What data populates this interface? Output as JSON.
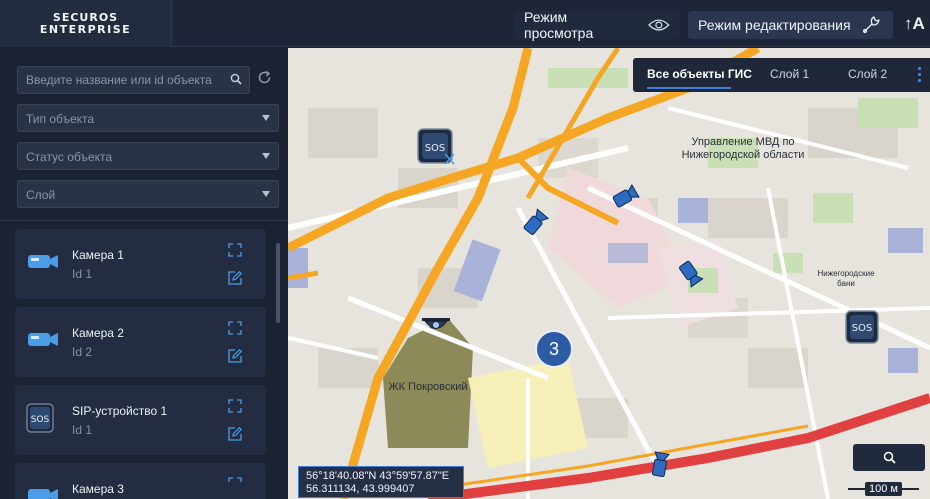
{
  "header": {
    "logo_line1": "SECUROS",
    "logo_line2": "ENTERPRISE",
    "view_mode_label": "Режим просмотра",
    "edit_mode_label": "Режим редактирования",
    "font_size_icon_text": "↑A"
  },
  "sidebar": {
    "search_placeholder": "Введите название или id объекта",
    "filters": [
      {
        "label": "Тип объекта"
      },
      {
        "label": "Статус объекта"
      },
      {
        "label": "Слой"
      }
    ],
    "objects": [
      {
        "name": "Камера 1",
        "id": "Id 1",
        "icon": "camera-icon"
      },
      {
        "name": "Камера 2",
        "id": "Id 2",
        "icon": "camera-icon"
      },
      {
        "name": "SIP-устройство 1",
        "id": "Id 1",
        "icon": "sos-phone-icon"
      },
      {
        "name": "Камера 3",
        "id": "",
        "icon": "camera-icon"
      }
    ]
  },
  "map": {
    "layer_tabs": [
      {
        "label": "Все объекты ГИС",
        "active": true
      },
      {
        "label": "Слой 1",
        "active": false
      },
      {
        "label": "Слой 2",
        "active": false
      }
    ],
    "labels": {
      "mvd_line1": "Управление МВД по",
      "mvd_line2": "Нижегородской области",
      "zhk": "ЖК Покровский",
      "banks": "Нижегородские бани"
    },
    "cluster_count": "3",
    "coords_dms": "56°18'40.08\"N 43°59'57.87\"E",
    "coords_decimal": "56.311134, 43.999407",
    "scale_label": "100 м",
    "colors": {
      "accent": "#3f7ed8",
      "panel": "#1b2333",
      "road_major": "#f5a623",
      "road_red": "#e04040"
    }
  }
}
